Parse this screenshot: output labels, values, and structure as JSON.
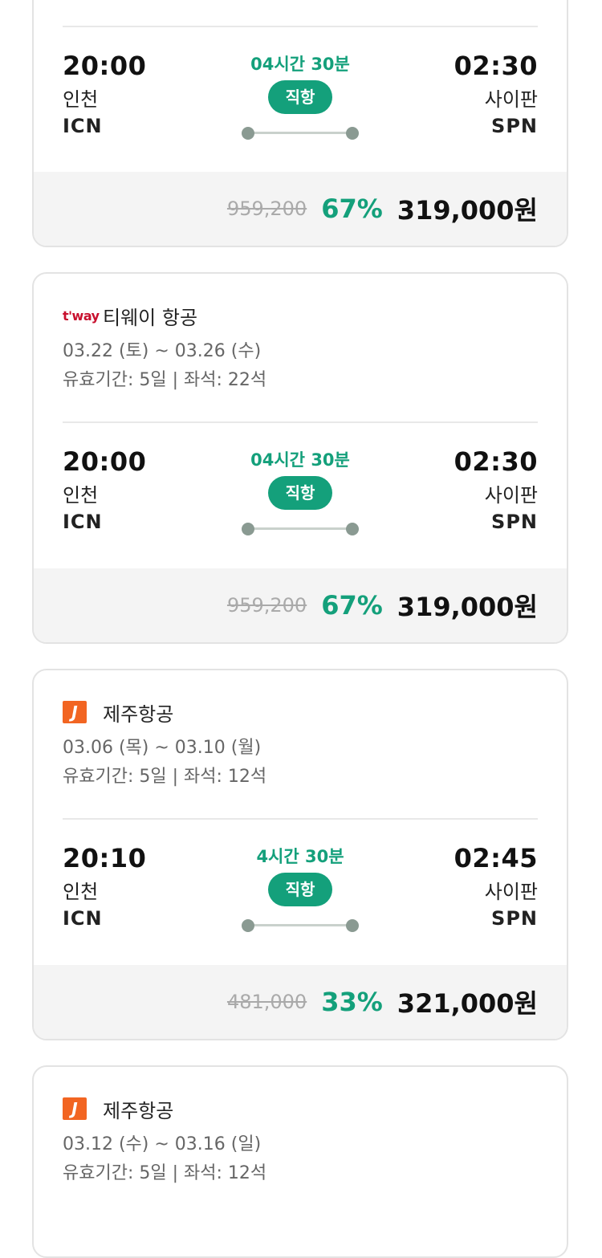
{
  "cards": [
    {
      "airline": null,
      "dep": {
        "time": "20:00",
        "city": "인천",
        "code": "ICN"
      },
      "arr": {
        "time": "02:30",
        "city": "사이판",
        "code": "SPN"
      },
      "duration": "04시간 30분",
      "badge": "직항",
      "price": {
        "original": "959,200",
        "discount": "67%",
        "final": "319,000원"
      }
    },
    {
      "airline": {
        "name": "티웨이 항공",
        "logo": "t'way"
      },
      "dates": "03.22 (토) ~ 03.26 (수)",
      "meta": "유효기간: 5일 | 좌석: 22석",
      "dep": {
        "time": "20:00",
        "city": "인천",
        "code": "ICN"
      },
      "arr": {
        "time": "02:30",
        "city": "사이판",
        "code": "SPN"
      },
      "duration": "04시간 30분",
      "badge": "직항",
      "price": {
        "original": "959,200",
        "discount": "67%",
        "final": "319,000원"
      }
    },
    {
      "airline": {
        "name": "제주항공",
        "logo": "J"
      },
      "dates": "03.06 (목) ~ 03.10 (월)",
      "meta": "유효기간: 5일 | 좌석: 12석",
      "dep": {
        "time": "20:10",
        "city": "인천",
        "code": "ICN"
      },
      "arr": {
        "time": "02:45",
        "city": "사이판",
        "code": "SPN"
      },
      "duration": "4시간 30분",
      "badge": "직항",
      "price": {
        "original": "481,000",
        "discount": "33%",
        "final": "321,000원"
      }
    },
    {
      "airline": {
        "name": "제주항공",
        "logo": "J"
      },
      "dates": "03.12 (수) ~ 03.16 (일)",
      "meta": "유효기간: 5일 | 좌석: 12석"
    }
  ],
  "colors": {
    "accent": "#14a07b",
    "tway": "#c8102e",
    "jeju": "#f26522"
  }
}
